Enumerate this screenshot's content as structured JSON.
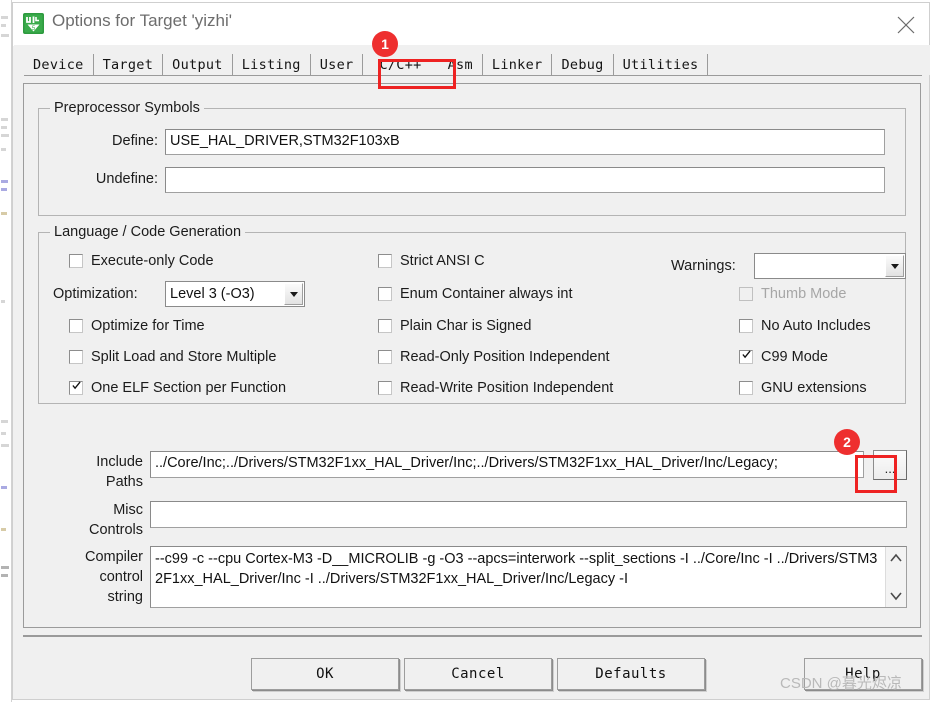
{
  "window": {
    "title": "Options for Target 'yizhi'",
    "icon": "keil-uvision-logo",
    "close_label": "✕"
  },
  "tabs": [
    {
      "label": "Device",
      "selected": false
    },
    {
      "label": "Target",
      "selected": false
    },
    {
      "label": "Output",
      "selected": false
    },
    {
      "label": "Listing",
      "selected": false
    },
    {
      "label": "User",
      "selected": false
    },
    {
      "label": "C/C++",
      "selected": true
    },
    {
      "label": "Asm",
      "selected": false
    },
    {
      "label": "Linker",
      "selected": false
    },
    {
      "label": "Debug",
      "selected": false
    },
    {
      "label": "Utilities",
      "selected": false
    }
  ],
  "preprocessor": {
    "legend": "Preprocessor Symbols",
    "define_label": "Define:",
    "define_value": "USE_HAL_DRIVER,STM32F103xB",
    "undefine_label": "Undefine:",
    "undefine_value": ""
  },
  "language": {
    "legend": "Language / Code Generation",
    "col1": [
      {
        "label": "Execute-only Code",
        "checked": false,
        "enabled": true
      },
      {
        "label": "Optimize for Time",
        "checked": false,
        "enabled": true
      },
      {
        "label": "Split Load and Store Multiple",
        "checked": false,
        "enabled": true
      },
      {
        "label": "One ELF Section per Function",
        "checked": true,
        "enabled": true
      }
    ],
    "optimization_label": "Optimization:",
    "optimization_value": "Level 3 (-O3)",
    "col2": [
      {
        "label": "Strict ANSI C",
        "checked": false,
        "enabled": true
      },
      {
        "label": "Enum Container always int",
        "checked": false,
        "enabled": true
      },
      {
        "label": "Plain Char is Signed",
        "checked": false,
        "enabled": true
      },
      {
        "label": "Read-Only Position Independent",
        "checked": false,
        "enabled": true
      },
      {
        "label": "Read-Write Position Independent",
        "checked": false,
        "enabled": true
      }
    ],
    "warnings_label": "Warnings:",
    "warnings_value": "",
    "col3": [
      {
        "label": "Thumb Mode",
        "checked": false,
        "enabled": false
      },
      {
        "label": "No Auto Includes",
        "checked": false,
        "enabled": true
      },
      {
        "label": "C99 Mode",
        "checked": true,
        "enabled": true
      },
      {
        "label": "GNU extensions",
        "checked": false,
        "enabled": true
      }
    ]
  },
  "paths": {
    "include_label_line1": "Include",
    "include_label_line2": "Paths",
    "include_value": "../Core/Inc;../Drivers/STM32F1xx_HAL_Driver/Inc;../Drivers/STM32F1xx_HAL_Driver/Inc/Legacy;",
    "browse_label": "...",
    "misc_label_line1": "Misc",
    "misc_label_line2": "Controls",
    "misc_value": "",
    "compiler_label_line1": "Compiler",
    "compiler_label_line2": "control",
    "compiler_label_line3": "string",
    "compiler_value": "--c99 -c --cpu Cortex-M3 -D__MICROLIB -g -O3 --apcs=interwork --split_sections -I ../Core/Inc -I ../Drivers/STM32F1xx_HAL_Driver/Inc -I ../Drivers/STM32F1xx_HAL_Driver/Inc/Legacy -I"
  },
  "buttons": {
    "ok": "OK",
    "cancel": "Cancel",
    "defaults": "Defaults",
    "help": "Help"
  },
  "annotations": [
    {
      "badge": "1",
      "target": "c-cpp-tab"
    },
    {
      "badge": "2",
      "target": "include-paths-browse-button"
    }
  ],
  "watermark": "CSDN @暮光烬凉"
}
